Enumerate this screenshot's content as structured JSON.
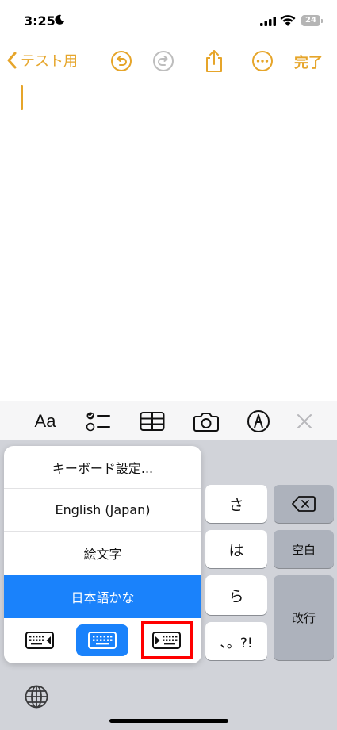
{
  "status_bar": {
    "time": "3:25",
    "battery": "24"
  },
  "nav": {
    "back_label": "テスト用",
    "done_label": "完了"
  },
  "toolbar": {
    "format_label": "Aa"
  },
  "keyboard": {
    "keys": [
      "さ",
      "は",
      "ら",
      "、。?!"
    ],
    "space_label": "空白",
    "return_label": "改行"
  },
  "keyboard_menu": {
    "items": [
      "キーボード設定...",
      "English (Japan)",
      "絵文字",
      "日本語かな"
    ],
    "selected": "日本語かな"
  },
  "colors": {
    "accent": "#e6a52a",
    "selection": "#1a82fb",
    "highlight": "#ff0000"
  }
}
